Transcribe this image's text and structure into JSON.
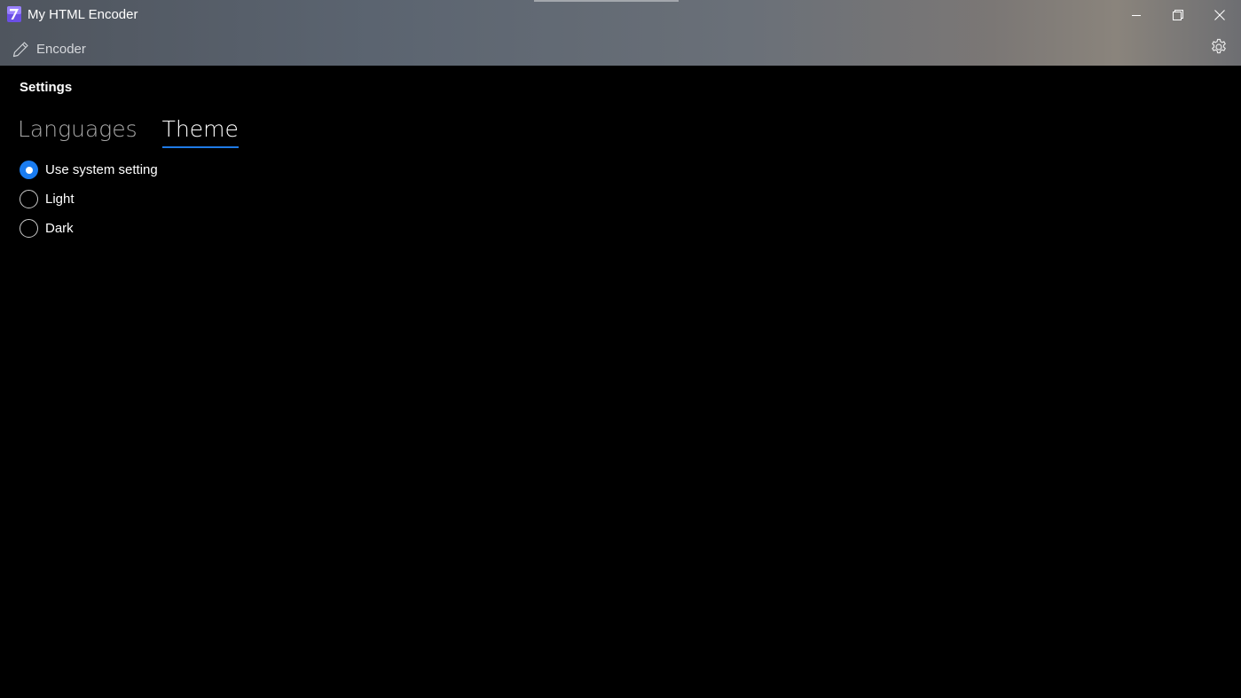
{
  "window": {
    "title": "My HTML Encoder"
  },
  "nav": {
    "encoder_label": "Encoder"
  },
  "page": {
    "title": "Settings"
  },
  "tabs": [
    {
      "label": "Languages",
      "selected": false
    },
    {
      "label": "Theme",
      "selected": true
    }
  ],
  "theme_options": [
    {
      "label": "Use system setting",
      "checked": true
    },
    {
      "label": "Light",
      "checked": false
    },
    {
      "label": "Dark",
      "checked": false
    }
  ],
  "icons": {
    "app": "app-logo-icon",
    "minimize": "minimize-icon",
    "restore": "restore-icon",
    "close": "close-icon",
    "encoder": "pencil-icon",
    "settings": "gear-icon"
  },
  "colors": {
    "accent": "#1a7cf0",
    "background": "#000000",
    "tab_inactive": "#a8a8a8",
    "app_icon": "#7b61ff"
  }
}
